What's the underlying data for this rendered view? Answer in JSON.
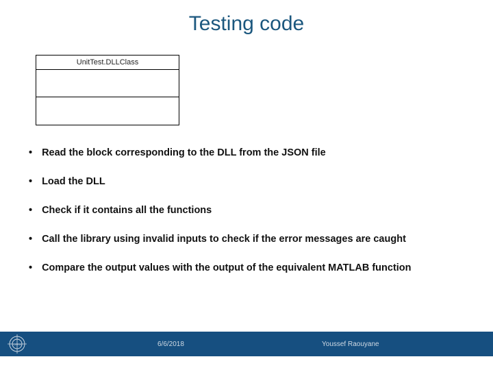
{
  "title": "Testing code",
  "class_box": {
    "name": "UnitTest.DLLClass"
  },
  "bullets": [
    "Read the block corresponding to the DLL from the JSON file",
    "Load the DLL",
    "Check if it contains all the functions",
    "Call the library using invalid inputs to check if the error messages are caught",
    "Compare the output values with the output of the equivalent MATLAB function"
  ],
  "footer": {
    "logo_label": "CERN",
    "date": "6/6/2018",
    "author": "Youssef Raouyane"
  }
}
